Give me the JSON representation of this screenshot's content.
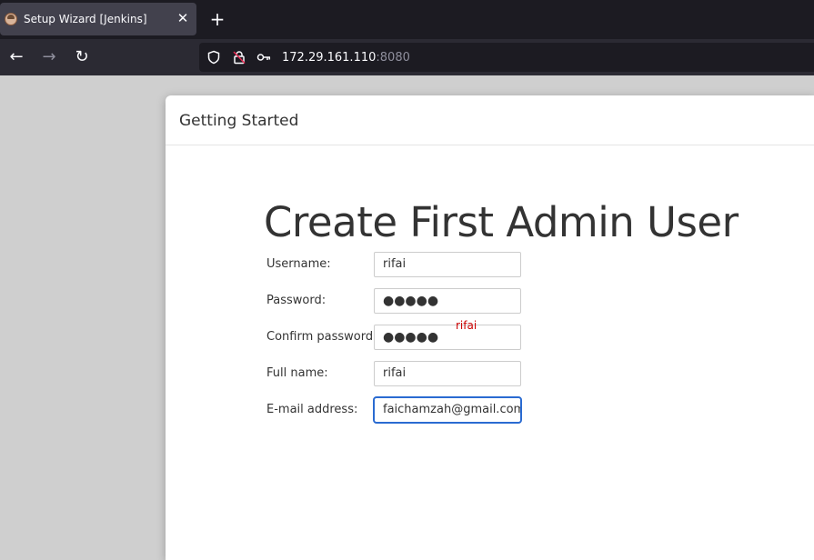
{
  "browser": {
    "tab_title": "Setup Wizard [Jenkins]",
    "tab_close": "✕",
    "new_tab": "+",
    "back": "←",
    "forward": "→",
    "reload": "↻",
    "url_host": "172.29.161.110",
    "url_port": ":8080"
  },
  "dialog": {
    "header_title": "Getting Started",
    "heading": "Create First Admin User",
    "fields": [
      {
        "label": "Username:",
        "value": "rifai"
      },
      {
        "label": "Password:",
        "value": "●●●●●"
      },
      {
        "label": "Confirm password:",
        "value": "●●●●●"
      },
      {
        "label": "Full name:",
        "value": "rifai"
      },
      {
        "label": "E-mail address:",
        "value": "faichamzah@gmail.com"
      }
    ],
    "overlay_text": "rifai"
  },
  "colors": {
    "accent_focus": "#2a6bd1",
    "error": "#cc0000",
    "chrome_dark": "#1c1b22",
    "chrome_mid": "#2b2a33"
  }
}
